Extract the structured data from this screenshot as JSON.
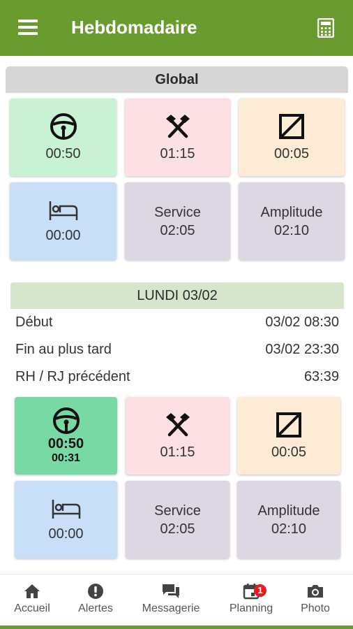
{
  "header": {
    "title": "Hebdomadaire",
    "menu_icon": "menu-icon",
    "calculator_icon": "calculator-icon",
    "color": "#6a9b2f"
  },
  "global": {
    "title": "Global",
    "tiles": [
      {
        "icon": "steering-wheel-icon",
        "value": "00:50",
        "color": "#c9f2d4"
      },
      {
        "icon": "crossed-hammers-icon",
        "value": "01:15",
        "color": "#fde0e3"
      },
      {
        "icon": "availability-square-icon",
        "value": "00:05",
        "color": "#fdebd6"
      },
      {
        "icon": "bed-icon",
        "value": "00:00",
        "color": "#c8dff7"
      },
      {
        "label": "Service",
        "value": "02:05",
        "color": "#dcd7e3"
      },
      {
        "label": "Amplitude",
        "value": "02:10",
        "color": "#dcd7e3"
      }
    ]
  },
  "day": {
    "title": "LUNDI 03/02",
    "rows": [
      {
        "label": "Début",
        "value": "03/02 08:30"
      },
      {
        "label": "Fin au plus tard",
        "value": "03/02 23:30"
      },
      {
        "label": "RH / RJ précédent",
        "value": "63:39"
      }
    ],
    "tiles": [
      {
        "icon": "steering-wheel-icon",
        "value": "00:50",
        "sub": "00:31",
        "color": "#78d9a4"
      },
      {
        "icon": "crossed-hammers-icon",
        "value": "01:15",
        "color": "#fde0e3"
      },
      {
        "icon": "availability-square-icon",
        "value": "00:05",
        "color": "#fdebd6"
      },
      {
        "icon": "bed-icon",
        "value": "00:00",
        "color": "#c8dff7"
      },
      {
        "label": "Service",
        "value": "02:05",
        "color": "#dcd7e3"
      },
      {
        "label": "Amplitude",
        "value": "02:10",
        "color": "#dcd7e3"
      }
    ]
  },
  "nav": {
    "items": [
      {
        "label": "Accueil",
        "icon": "home-icon"
      },
      {
        "label": "Alertes",
        "icon": "alert-icon"
      },
      {
        "label": "Messagerie",
        "icon": "chat-icon"
      },
      {
        "label": "Planning",
        "icon": "calendar-icon",
        "badge": "1"
      },
      {
        "label": "Photo",
        "icon": "camera-icon"
      }
    ]
  }
}
